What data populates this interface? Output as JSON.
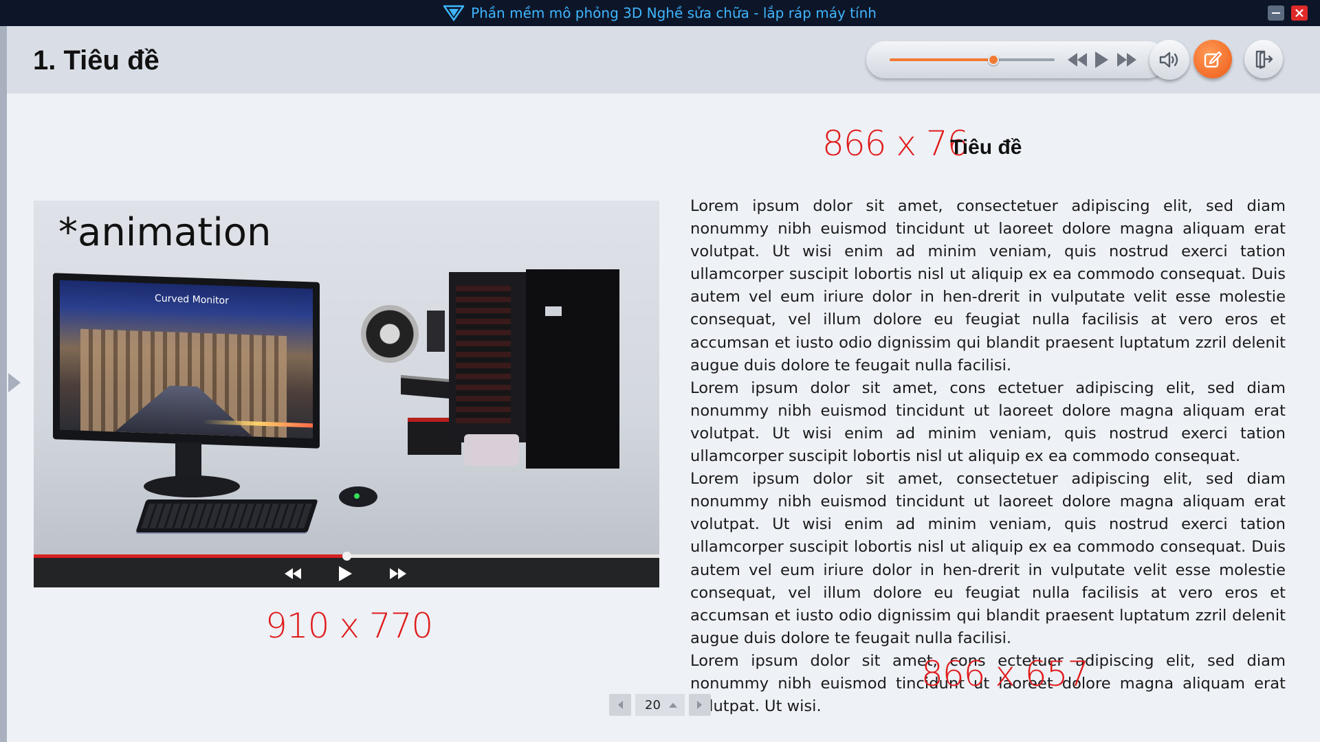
{
  "window": {
    "title": "Phần mềm mô phỏng 3D Nghề sửa chữa - lắp ráp máy tính"
  },
  "header": {
    "title": "1.  Tiêu đề"
  },
  "media": {
    "volume_fraction": 0.63
  },
  "content": {
    "title_dims": "866 x 76",
    "subtitle": "Tiêu đề",
    "video_label": "*animation",
    "monitor_text": "Curved Monitor",
    "video_progress_fraction": 0.5,
    "video_dims": "910 x 770",
    "text_dims": "866 x 657",
    "paragraphs": [
      "Lorem ipsum dolor sit amet, consectetuer adipiscing elit, sed diam nonummy nibh euismod tincidunt ut laoreet dolore magna aliquam erat volutpat. Ut wisi enim ad minim veniam, quis nostrud exerci tation ullamcorper suscipit lobortis nisl ut aliquip ex ea commodo consequat. Duis autem vel eum iriure dolor in hen-drerit in vulputate velit esse molestie consequat, vel illum dolore eu feugiat nulla facilisis at vero eros et accumsan et iusto odio dignissim qui blandit praesent luptatum zzril delenit augue duis dolore te feugait nulla facilisi.",
      "Lorem ipsum dolor sit amet, cons ectetuer adipiscing elit, sed diam nonummy nibh euismod tincidunt ut laoreet dolore magna aliquam erat volutpat. Ut wisi enim ad minim veniam, quis nostrud exerci tation ullamcorper suscipit lobortis nisl ut aliquip ex ea commodo consequat.",
      "Lorem ipsum dolor sit amet, consectetuer adipiscing elit, sed diam nonummy nibh euismod tincidunt ut laoreet dolore magna aliquam erat volutpat. Ut wisi enim ad minim veniam, quis nostrud exerci tation ullamcorper suscipit lobortis nisl ut aliquip ex ea commodo consequat. Duis autem vel eum iriure dolor in hen-drerit in vulputate velit esse molestie consequat, vel illum dolore eu feugiat nulla facilisis at vero eros et accumsan et iusto odio dignissim qui blandit praesent luptatum zzril delenit augue duis dolore te feugait nulla facilisi.",
      "Lorem ipsum dolor sit amet, cons ectetuer adipiscing elit, sed diam nonummy nibh euismod tincidunt ut laoreet dolore magna aliquam erat volutpat. Ut wisi."
    ]
  },
  "pager": {
    "page": "20"
  },
  "icons": {
    "app_logo": "app-logo-icon",
    "minimize": "minimize-icon",
    "close": "close-icon",
    "rewind": "rewind-icon",
    "play": "play-icon",
    "fast_forward": "fast-forward-icon",
    "volume": "volume-icon",
    "edit": "edit-icon",
    "exit": "exit-icon",
    "prev": "prev-page-icon",
    "next": "next-page-icon",
    "expand": "expand-sidebar-icon"
  },
  "colors": {
    "titlebar_bg": "#0d1628",
    "title_text": "#3fb6ff",
    "accent_orange": "#f27a32",
    "dimension_red": "#e01b1b",
    "progress_red": "#d7211f"
  }
}
